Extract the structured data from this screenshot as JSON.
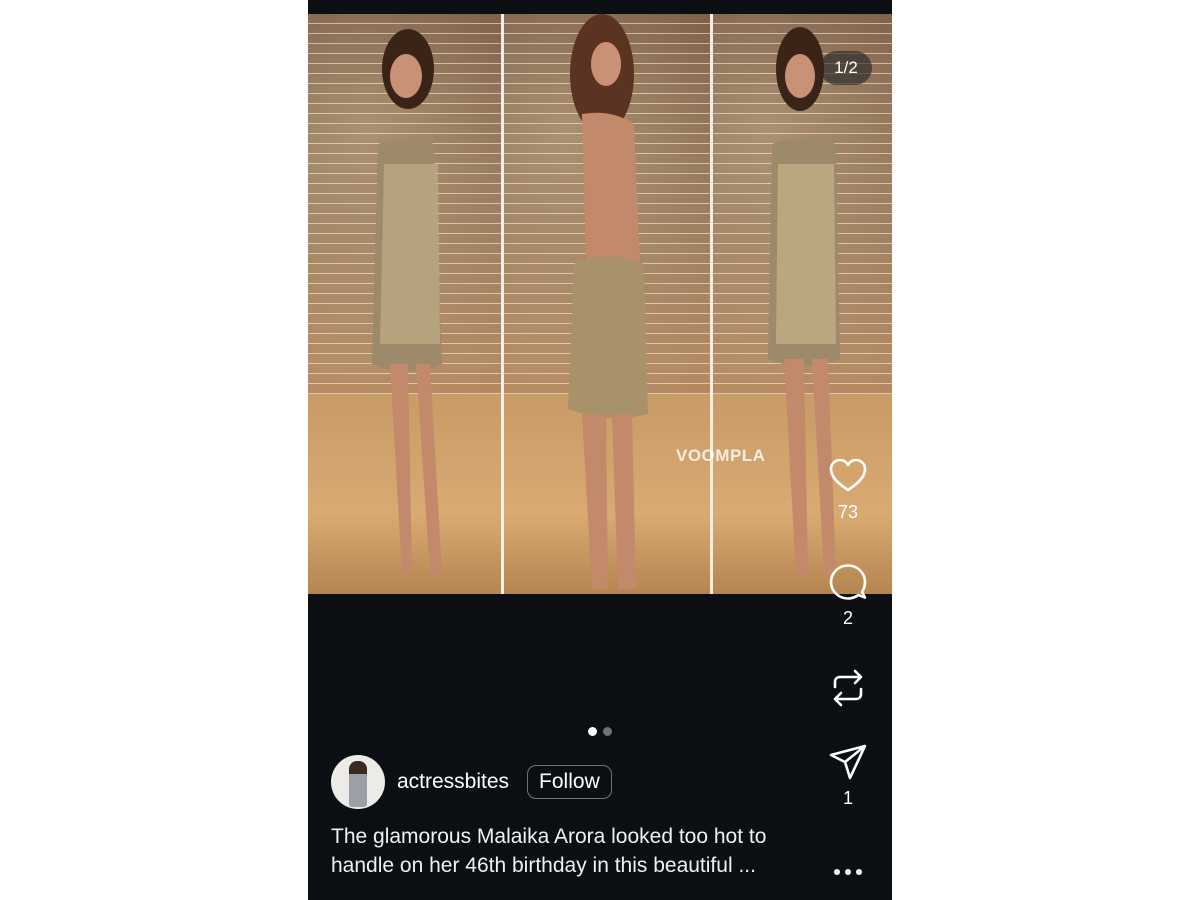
{
  "post": {
    "image_counter": "1/2",
    "watermark": "VOOMPLA",
    "carousel": {
      "current": 1,
      "total": 2
    }
  },
  "actions": {
    "like_count": "73",
    "comment_count": "2",
    "share_count": "1",
    "icons": [
      "heart-icon",
      "comment-icon",
      "repost-icon",
      "send-icon",
      "more-icon"
    ]
  },
  "author": {
    "username": "actressbites",
    "follow_label": "Follow"
  },
  "caption": {
    "text": "The glamorous Malaika Arora looked too hot to handle on her 46th birthday in this beautiful ..."
  },
  "colors": {
    "background": "#0b0f14",
    "text": "#ffffff",
    "dot_inactive": "#6e7278"
  }
}
